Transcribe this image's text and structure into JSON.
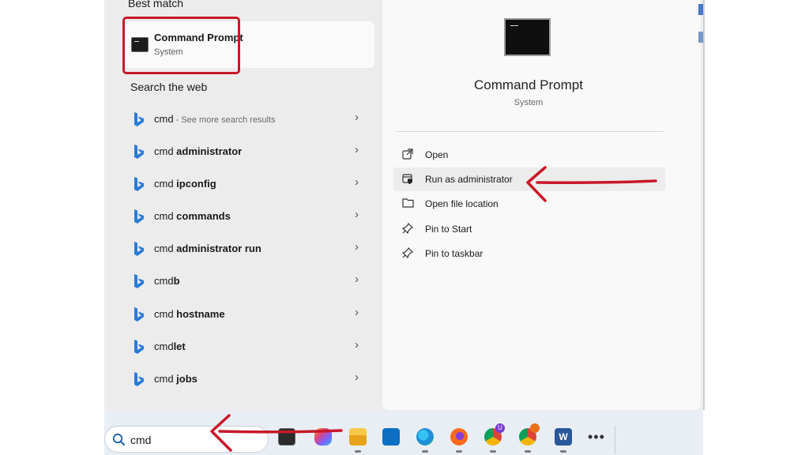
{
  "best_match": {
    "heading": "Best match",
    "title": "Command Prompt",
    "subtitle": "System"
  },
  "search_the_web": {
    "heading": "Search the web",
    "items": [
      {
        "prefix": "cmd",
        "bold": "",
        "hint": " - See more search results"
      },
      {
        "prefix": "cmd ",
        "bold": "administrator",
        "hint": ""
      },
      {
        "prefix": "cmd ",
        "bold": "ipconfig",
        "hint": ""
      },
      {
        "prefix": "cmd ",
        "bold": "commands",
        "hint": ""
      },
      {
        "prefix": "cmd ",
        "bold": "administrator run",
        "hint": ""
      },
      {
        "prefix": "cmd",
        "bold": "b",
        "hint": ""
      },
      {
        "prefix": "cmd ",
        "bold": "hostname",
        "hint": ""
      },
      {
        "prefix": "cmd",
        "bold": "let",
        "hint": ""
      },
      {
        "prefix": "cmd ",
        "bold": "jobs",
        "hint": ""
      }
    ]
  },
  "details": {
    "title": "Command Prompt",
    "subtitle": "System",
    "actions": [
      {
        "label": "Open",
        "icon": "open-external-icon"
      },
      {
        "label": "Run as administrator",
        "icon": "shield-admin-icon"
      },
      {
        "label": "Open file location",
        "icon": "folder-icon"
      },
      {
        "label": "Pin to Start",
        "icon": "pin-icon"
      },
      {
        "label": "Pin to taskbar",
        "icon": "pin-icon"
      }
    ]
  },
  "taskbar": {
    "search_value": "cmd",
    "apps": [
      "terminal",
      "copilot",
      "file-explorer",
      "microsoft-store",
      "edge",
      "firefox",
      "chrome-profile-u",
      "chrome",
      "word"
    ]
  },
  "colors": {
    "annotation_red": "#c8182a",
    "bing_blue": "#2b7bd6"
  }
}
